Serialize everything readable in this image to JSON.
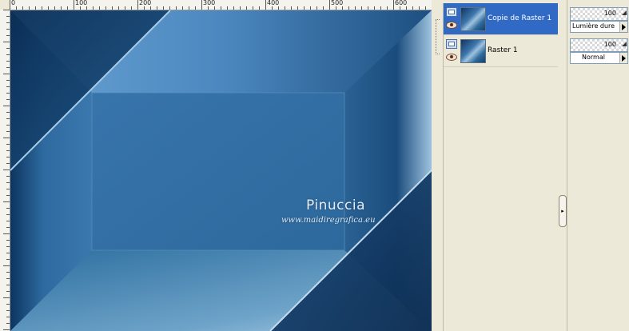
{
  "ruler": {
    "labels": [
      "0",
      "100",
      "200",
      "300",
      "400",
      "500",
      "600"
    ]
  },
  "watermark": {
    "title": "Pinuccia",
    "url": "www.maidiregrafica.eu"
  },
  "layers": [
    {
      "name": "Copie de Raster 1",
      "selected": true,
      "visible": true,
      "opacity": "100",
      "blend_mode": "Lumière dure"
    },
    {
      "name": "Raster 1",
      "selected": false,
      "visible": true,
      "opacity": "100",
      "blend_mode": "Normal"
    }
  ],
  "icons": {
    "layer_type": "raster-layer-icon",
    "visibility": "eye-icon",
    "collapse": "chevron-right-icon",
    "spin": "spin-icon",
    "dropdown": "dropdown-arrow-icon"
  },
  "colors": {
    "selection": "#316ac5",
    "panel_bg": "#ece9d8",
    "image_main": "#2a6aa2"
  }
}
